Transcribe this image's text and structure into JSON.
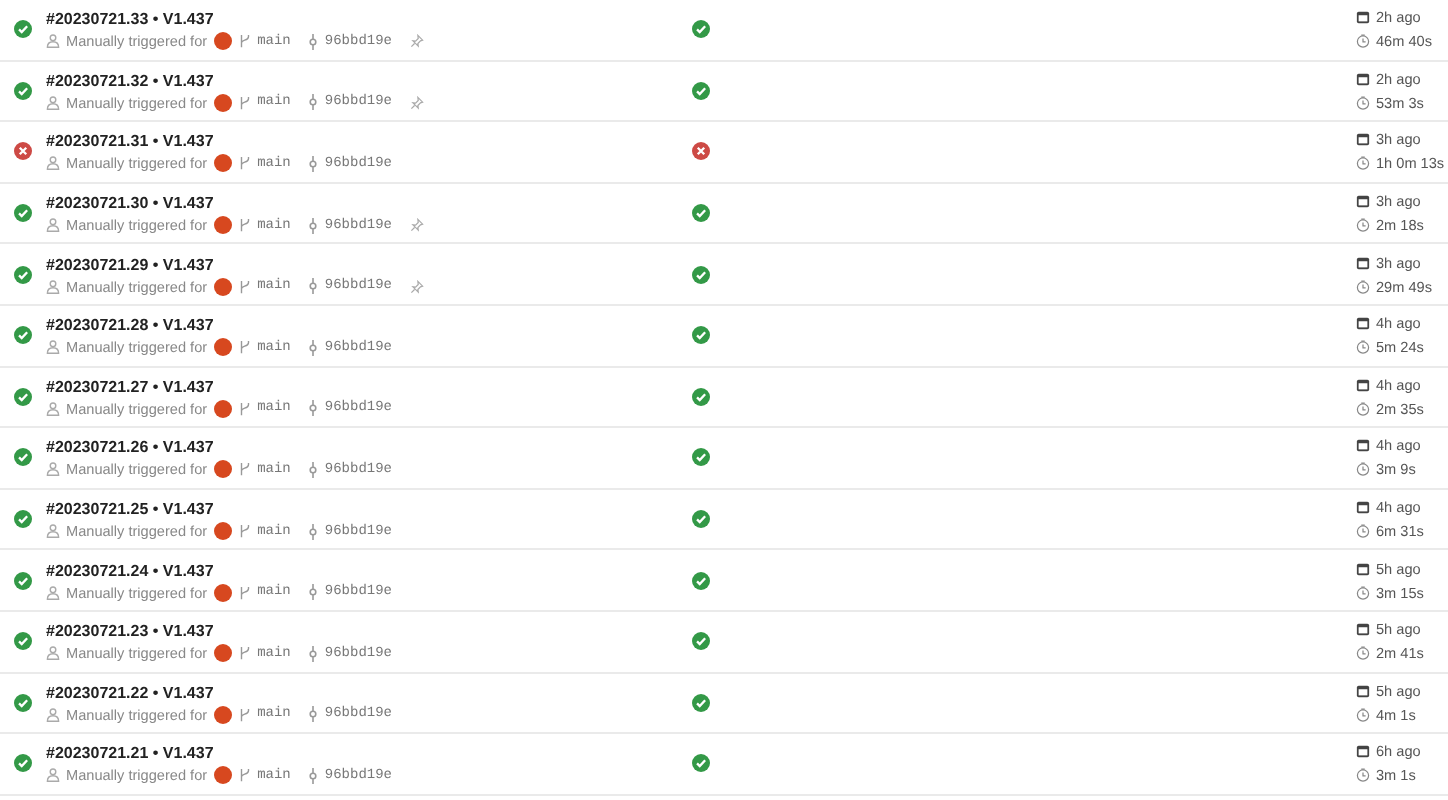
{
  "runs": [
    {
      "title": "#20230721.33 • V1.437",
      "failed": false,
      "trigger": "Manually triggered for",
      "branch": "main",
      "commit": "96bbd19e",
      "retained": true,
      "stage_failed": false,
      "ago": "2h ago",
      "duration": "46m 40s"
    },
    {
      "title": "#20230721.32 • V1.437",
      "failed": false,
      "trigger": "Manually triggered for",
      "branch": "main",
      "commit": "96bbd19e",
      "retained": true,
      "stage_failed": false,
      "ago": "2h ago",
      "duration": "53m 3s"
    },
    {
      "title": "#20230721.31 • V1.437",
      "failed": true,
      "trigger": "Manually triggered for",
      "branch": "main",
      "commit": "96bbd19e",
      "retained": false,
      "stage_failed": true,
      "ago": "3h ago",
      "duration": "1h 0m 13s"
    },
    {
      "title": "#20230721.30 • V1.437",
      "failed": false,
      "trigger": "Manually triggered for",
      "branch": "main",
      "commit": "96bbd19e",
      "retained": true,
      "stage_failed": false,
      "ago": "3h ago",
      "duration": "2m 18s"
    },
    {
      "title": "#20230721.29 • V1.437",
      "failed": false,
      "trigger": "Manually triggered for",
      "branch": "main",
      "commit": "96bbd19e",
      "retained": true,
      "stage_failed": false,
      "ago": "3h ago",
      "duration": "29m 49s"
    },
    {
      "title": "#20230721.28 • V1.437",
      "failed": false,
      "trigger": "Manually triggered for",
      "branch": "main",
      "commit": "96bbd19e",
      "retained": false,
      "stage_failed": false,
      "ago": "4h ago",
      "duration": "5m 24s"
    },
    {
      "title": "#20230721.27 • V1.437",
      "failed": false,
      "trigger": "Manually triggered for",
      "branch": "main",
      "commit": "96bbd19e",
      "retained": false,
      "stage_failed": false,
      "ago": "4h ago",
      "duration": "2m 35s"
    },
    {
      "title": "#20230721.26 • V1.437",
      "failed": false,
      "trigger": "Manually triggered for",
      "branch": "main",
      "commit": "96bbd19e",
      "retained": false,
      "stage_failed": false,
      "ago": "4h ago",
      "duration": "3m 9s"
    },
    {
      "title": "#20230721.25 • V1.437",
      "failed": false,
      "trigger": "Manually triggered for",
      "branch": "main",
      "commit": "96bbd19e",
      "retained": false,
      "stage_failed": false,
      "ago": "4h ago",
      "duration": "6m 31s"
    },
    {
      "title": "#20230721.24 • V1.437",
      "failed": false,
      "trigger": "Manually triggered for",
      "branch": "main",
      "commit": "96bbd19e",
      "retained": false,
      "stage_failed": false,
      "ago": "5h ago",
      "duration": "3m 15s"
    },
    {
      "title": "#20230721.23 • V1.437",
      "failed": false,
      "trigger": "Manually triggered for",
      "branch": "main",
      "commit": "96bbd19e",
      "retained": false,
      "stage_failed": false,
      "ago": "5h ago",
      "duration": "2m 41s"
    },
    {
      "title": "#20230721.22 • V1.437",
      "failed": false,
      "trigger": "Manually triggered for",
      "branch": "main",
      "commit": "96bbd19e",
      "retained": false,
      "stage_failed": false,
      "ago": "5h ago",
      "duration": "4m 1s"
    },
    {
      "title": "#20230721.21 • V1.437",
      "failed": false,
      "trigger": "Manually triggered for",
      "branch": "main",
      "commit": "96bbd19e",
      "retained": false,
      "stage_failed": false,
      "ago": "6h ago",
      "duration": "3m 1s"
    }
  ]
}
